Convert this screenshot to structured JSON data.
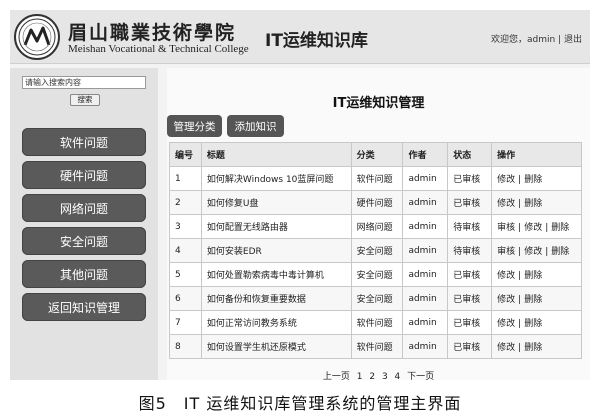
{
  "header": {
    "school_cn": "眉山職業技術學院",
    "school_en": "Meishan Vocational & Technical College",
    "app_title": "IT运维知识库",
    "welcome": "欢迎您，",
    "username": "admin",
    "separator": "|",
    "logout": "退出"
  },
  "sidebar": {
    "search_placeholder": "请输入搜索内容",
    "search_button": "搜索",
    "items": [
      {
        "label": "软件问题"
      },
      {
        "label": "硬件问题"
      },
      {
        "label": "网络问题"
      },
      {
        "label": "安全问题"
      },
      {
        "label": "其他问题"
      },
      {
        "label": "返回知识管理"
      }
    ]
  },
  "main": {
    "title": "IT运维知识管理",
    "buttons": {
      "category": "管理分类",
      "add": "添加知识"
    },
    "columns": [
      "编号",
      "标题",
      "分类",
      "作者",
      "状态",
      "操作"
    ],
    "rows": [
      {
        "id": "1",
        "title": "如何解决Windows 10蓝屏问题",
        "category": "软件问题",
        "author": "admin",
        "status": "已审核",
        "ops": [
          "修改",
          "删除"
        ]
      },
      {
        "id": "2",
        "title": "如何修复U盘",
        "category": "硬件问题",
        "author": "admin",
        "status": "已审核",
        "ops": [
          "修改",
          "删除"
        ]
      },
      {
        "id": "3",
        "title": "如何配置无线路由器",
        "category": "网络问题",
        "author": "admin",
        "status": "待审核",
        "ops": [
          "审核",
          "修改",
          "删除"
        ]
      },
      {
        "id": "4",
        "title": "如何安装EDR",
        "category": "安全问题",
        "author": "admin",
        "status": "待审核",
        "ops": [
          "审核",
          "修改",
          "删除"
        ]
      },
      {
        "id": "5",
        "title": "如何处置勒索病毒中毒计算机",
        "category": "安全问题",
        "author": "admin",
        "status": "已审核",
        "ops": [
          "修改",
          "删除"
        ]
      },
      {
        "id": "6",
        "title": "如何备份和恢复重要数据",
        "category": "安全问题",
        "author": "admin",
        "status": "已审核",
        "ops": [
          "修改",
          "删除"
        ]
      },
      {
        "id": "7",
        "title": "如何正常访问教务系统",
        "category": "软件问题",
        "author": "admin",
        "status": "已审核",
        "ops": [
          "修改",
          "删除"
        ]
      },
      {
        "id": "8",
        "title": "如何设置学生机还原模式",
        "category": "软件问题",
        "author": "admin",
        "status": "已审核",
        "ops": [
          "修改",
          "删除"
        ]
      }
    ],
    "op_separator": "|",
    "pagination": {
      "prev": "上一页",
      "pages": [
        "1",
        "2",
        "3",
        "4"
      ],
      "next": "下一页"
    }
  },
  "caption": "图5　IT 运维知识库管理系统的管理主界面"
}
